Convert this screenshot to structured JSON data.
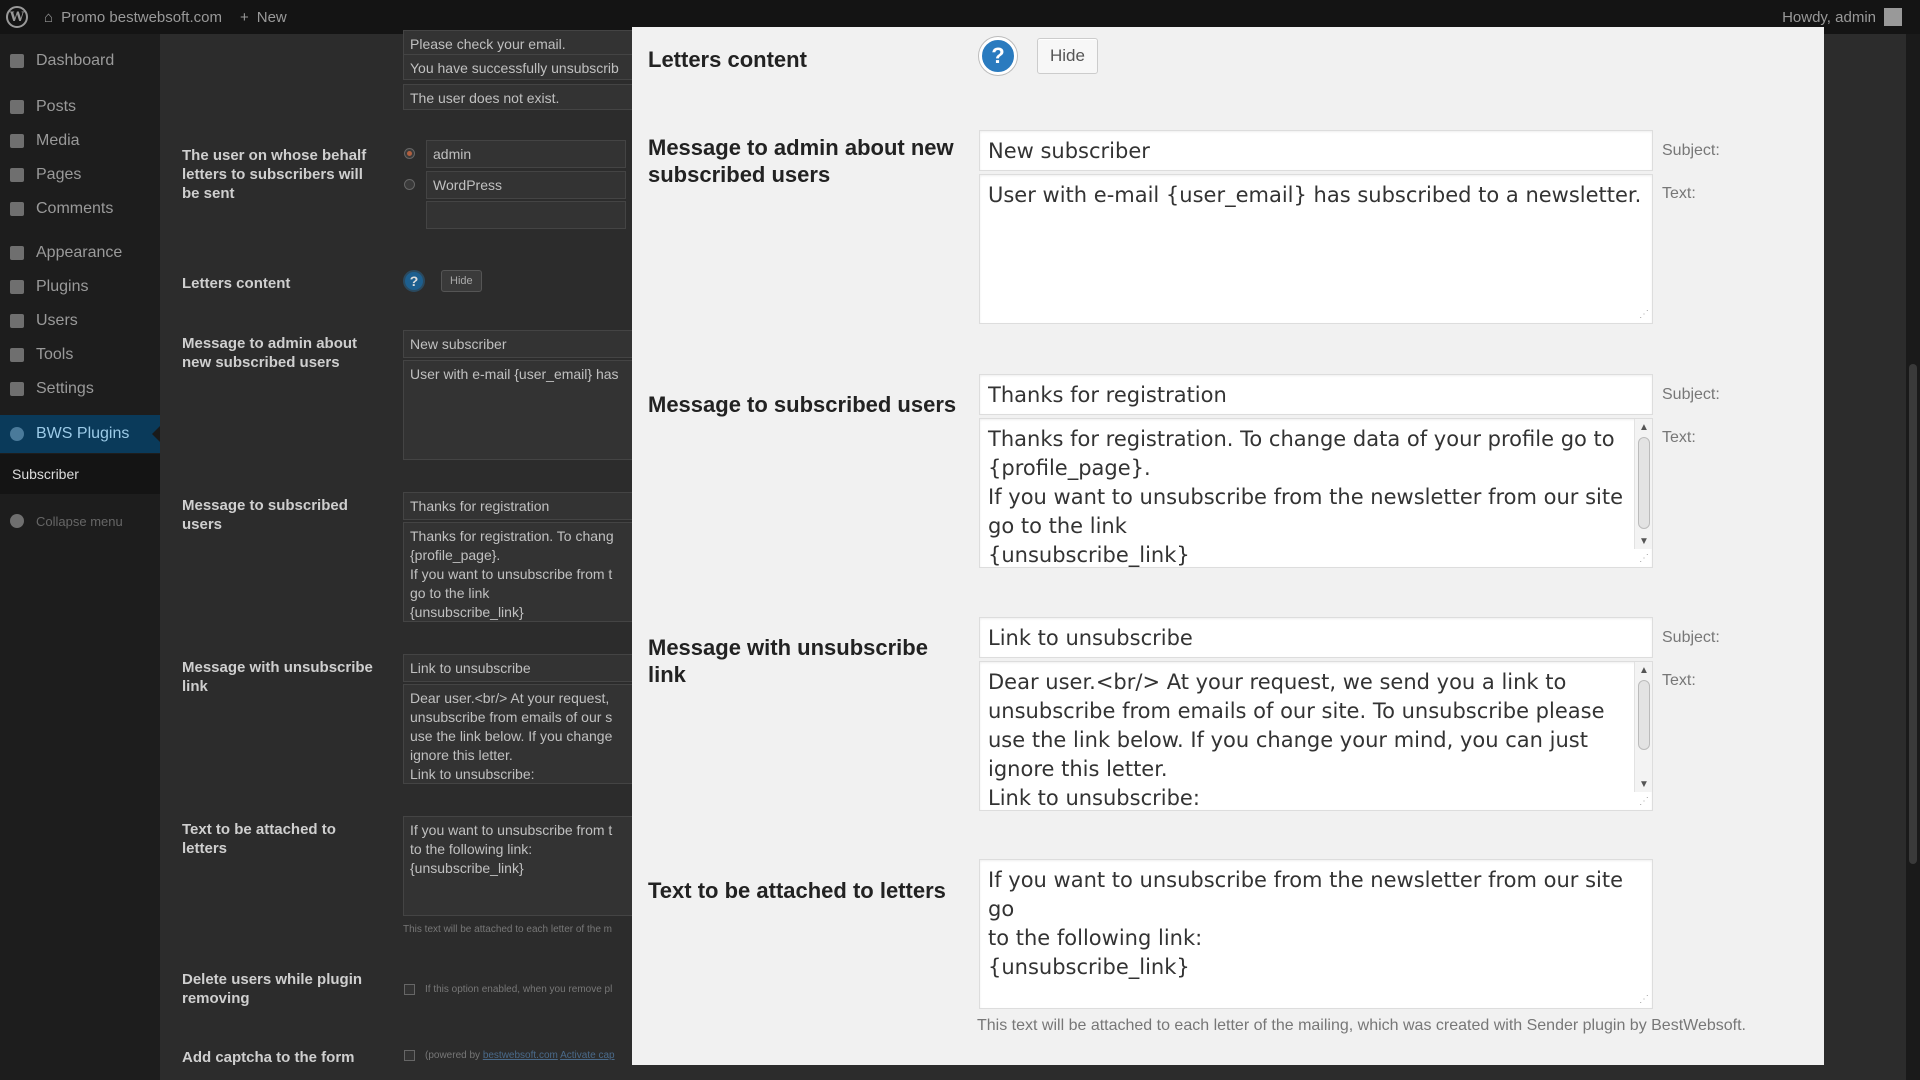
{
  "admin_bar": {
    "site_name": "Promo bestwebsoft.com",
    "new_label": "New",
    "howdy": "Howdy, admin"
  },
  "sidebar": {
    "items": [
      {
        "label": "Dashboard",
        "icon": "dashboard-icon"
      },
      {
        "label": "Posts",
        "icon": "pin-icon"
      },
      {
        "label": "Media",
        "icon": "media-icon"
      },
      {
        "label": "Pages",
        "icon": "pages-icon"
      },
      {
        "label": "Comments",
        "icon": "comments-icon"
      },
      {
        "label": "Appearance",
        "icon": "brush-icon"
      },
      {
        "label": "Plugins",
        "icon": "plug-icon"
      },
      {
        "label": "Users",
        "icon": "user-icon"
      },
      {
        "label": "Tools",
        "icon": "wrench-icon"
      },
      {
        "label": "Settings",
        "icon": "settings-icon"
      },
      {
        "label": "BWS Plugins",
        "icon": "bws-icon"
      }
    ],
    "submenu_label": "Subscriber",
    "collapse_label": "Collapse menu"
  },
  "background": {
    "top_messages": [
      "Please check your email.",
      "You have successfully unsubscrib",
      "The user does not exist."
    ],
    "sender_label": "The user on whose behalf letters to subscribers will be sent",
    "sender_options": [
      "admin",
      "WordPress"
    ],
    "letters_content_label": "Letters content",
    "hide_label": "Hide",
    "admin_msg_label": "Message to admin about new subscribed users",
    "admin_msg_subject": "New subscriber",
    "admin_msg_text": "User with e-mail {user_email} has",
    "subscribed_label": "Message to subscribed users",
    "subscribed_subject": "Thanks for registration",
    "subscribed_text": "Thanks for registration. To chang\n{profile_page}.\nIf you want to unsubscribe from t\ngo to the link\n{unsubscribe_link}",
    "unsub_label": "Message with unsubscribe link",
    "unsub_subject": "Link to unsubscribe",
    "unsub_text": "Dear user.<br/> At your request,\nunsubscribe from emails of our s\nuse the link below. If you change\nignore this letter.\nLink to unsubscribe:",
    "attach_label": "Text to be attached to letters",
    "attach_text": "If you want to unsubscribe from t\nto the following link:\n{unsubscribe_link}",
    "attach_note": "This text will be attached to each letter of the m",
    "delete_label": "Delete users while plugin removing",
    "delete_note": "If this option enabled, when you remove pl",
    "captcha_label": "Add captcha to the form",
    "captcha_note_prefix": "(powered by ",
    "captcha_link": "bestwebsoft.com",
    "captcha_activate": "Activate cap"
  },
  "modal": {
    "title": "Letters content",
    "hide_label": "Hide",
    "subject_side": "Subject:",
    "text_side": "Text:",
    "admin_msg": {
      "label": "Message to admin about new subscribed users",
      "subject": "New subscriber",
      "text": "User with e-mail {user_email} has subscribed to a newsletter."
    },
    "subscribed_msg": {
      "label": "Message to subscribed users",
      "subject": "Thanks for registration",
      "text": "Thanks for registration. To change data of your profile go to\n{profile_page}.\nIf you want to unsubscribe from the newsletter from our site\ngo to the link\n{unsubscribe_link}"
    },
    "unsub_msg": {
      "label": "Message with unsubscribe link",
      "subject": "Link to unsubscribe",
      "text": "Dear user.<br/> At your request, we send you a link to\nunsubscribe from emails of our site. To unsubscribe please\nuse the link below. If you change your mind, you can just\nignore this letter.\nLink to unsubscribe:"
    },
    "attach_msg": {
      "label": "Text to be attached to letters",
      "text": "If you want to unsubscribe from the newsletter from our site go\nto the following link:\n{unsubscribe_link}",
      "note": "This text will be attached to each letter of the mailing, which was created with Sender plugin by BestWebsoft."
    }
  },
  "colors": {
    "modal_bg": "#f1f1f1",
    "help_blue": "#2a7bbf",
    "sidebar_active": "#0a3a5a"
  }
}
